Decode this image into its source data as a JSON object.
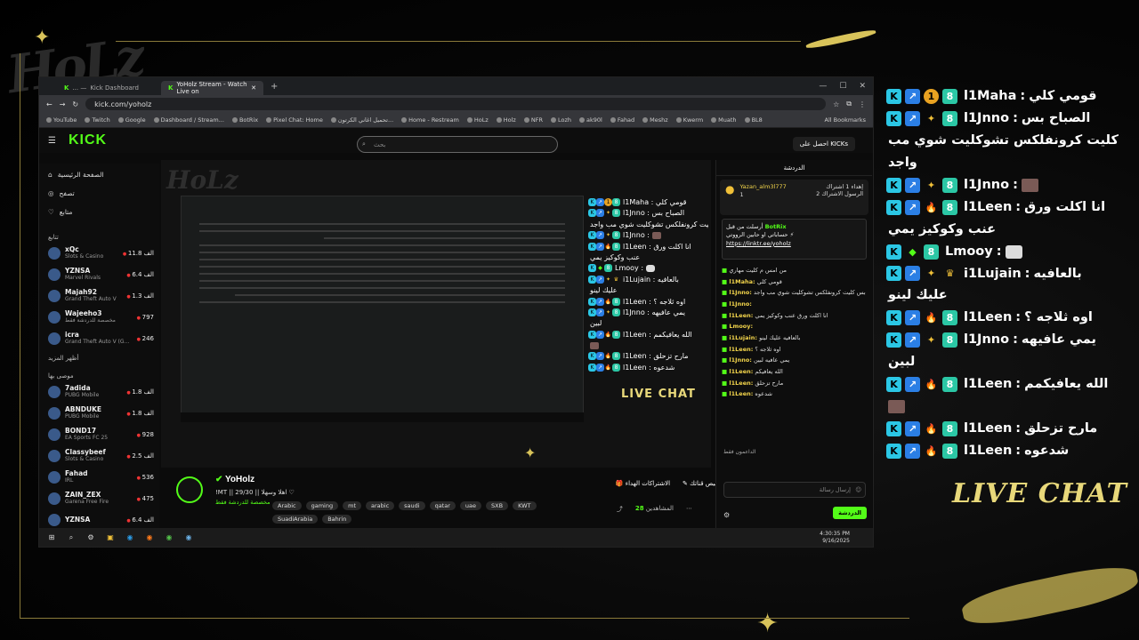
{
  "browser": {
    "tabs": [
      {
        "label": "Kick Dashboard",
        "prefix": "... —"
      },
      {
        "label": "YoHolz Stream - Watch Live on"
      }
    ],
    "url": "kick.com/yoholz",
    "bookmarks": [
      "YouTube",
      "Twitch",
      "Google",
      "Dashboard / Stream...",
      "BotRix",
      "Pixel Chat: Home",
      "تحميل اغاني الكرتون...",
      "Home - Restream",
      "HoLz",
      "Holz",
      "NFR",
      "Lozh",
      "ak90l",
      "Fahad",
      "Meshz",
      "Kwerm",
      "Muath",
      "BL8"
    ],
    "all_bookmarks": "All Bookmarks"
  },
  "kick": {
    "logo": "KICK",
    "search_placeholder": "بحث",
    "get_kicks": "احصل على KICKs",
    "nav": [
      "الصفحة الرئيسية",
      "تصفح",
      "متابع"
    ],
    "following_title": "تتابع",
    "following": [
      {
        "name": "xQc",
        "cat": "Slots & Casino",
        "viewers": "11.8 الف"
      },
      {
        "name": "YZNSA",
        "cat": "Marvel Rivals",
        "viewers": "6.4 الف"
      },
      {
        "name": "Majah92",
        "cat": "Grand Theft Auto V",
        "viewers": "1.3 الف"
      },
      {
        "name": "Wajeeho3",
        "cat": "مخصصة للدردشة فقط",
        "viewers": "797"
      },
      {
        "name": "icra",
        "cat": "Grand Theft Auto V (G...",
        "viewers": "246"
      }
    ],
    "show_more": "أظهر المزيد",
    "recommended_title": "موصى بها",
    "recommended": [
      {
        "name": "7adida",
        "cat": "PUBG Mobile",
        "viewers": "1.8 الف"
      },
      {
        "name": "ABNDUKE",
        "cat": "PUBG Mobile",
        "viewers": "1.8 الف"
      },
      {
        "name": "BOND17",
        "cat": "EA Sports FC 25",
        "viewers": "928"
      },
      {
        "name": "Classybeef",
        "cat": "Slots & Casino",
        "viewers": "2.5 الف"
      },
      {
        "name": "Fahad",
        "cat": "IRL",
        "viewers": "536"
      },
      {
        "name": "ZAIN_ZEX",
        "cat": "Garena Free Fire",
        "viewers": "475"
      },
      {
        "name": "YZNSA",
        "cat": "",
        "viewers": "6.4 الف"
      }
    ],
    "stream": {
      "channel": "YoHolz",
      "title": "!MT || 29/30 || اهلا وسهلا ♡",
      "category": "مخصصة للدردشة فقط",
      "tags": [
        "Arabic",
        "gaming",
        "mt",
        "arabic",
        "saudi",
        "qatar",
        "uae",
        "SXB",
        "KWT",
        "SuadiArabia",
        "Bahrin"
      ],
      "subs_btn": "الاشتراكات الهداء",
      "clip_btn": "تخصيص قناتك",
      "viewers_label": "المشاهدين",
      "viewers": "28"
    },
    "chat": {
      "header": "الدردشة",
      "pinned_user": "Yazan_alm3l777",
      "pinned_text": "إهداء 1 اشتراك الرسول الاشتراك 2",
      "pinned_count": "1",
      "bot_name": "BotRix",
      "bot_line1": "حساباتي او حابين الرووتي ⚡",
      "bot_link": "https://linktr.ee/yoholz",
      "bot_sent": "أرسلت من قبل",
      "messages": [
        {
          "u": "",
          "t": "من امس م كليت مهاري"
        },
        {
          "u": "l1Maha:",
          "t": "قومي كلي"
        },
        {
          "u": "l1Jnno:",
          "t": "الصباح بس كليت كرونفلكس تشوكليت شوي مب واجد."
        },
        {
          "u": "l1Jnno:",
          "t": ""
        },
        {
          "u": "l1Leen:",
          "t": "انا اكلت ورق عنب وكوكيز يمي"
        },
        {
          "u": "Lmooy:",
          "t": ""
        },
        {
          "u": "i1Lujain:",
          "t": "بالعافيه عليك لينو"
        },
        {
          "u": "l1Leen:",
          "t": "اوه ثلاجه ؟"
        },
        {
          "u": "l1Jnno:",
          "t": "يمي عافيه لبين"
        },
        {
          "u": "l1Leen:",
          "t": "الله يعافيكم"
        },
        {
          "u": "l1Leen:",
          "t": "مارح تزحلق"
        },
        {
          "u": "l1Leen:",
          "t": "شدعوه"
        }
      ],
      "supporters": "الداعمون فقط",
      "input_placeholder": "إرسال رسالة",
      "send_label": "الدردشة"
    }
  },
  "taskbar": {
    "time": "4:30:35 PM",
    "date": "9/16/2025"
  },
  "overlay": {
    "live_chat": "LIVE CHAT",
    "messages": [
      {
        "user": "l1Maha",
        "text": "قومي كلي",
        "badges": [
          "k",
          "s",
          "o",
          "g"
        ]
      },
      {
        "user": "l1Jnno",
        "text": "الصباح بس",
        "cont": "كليت كرونفلكس تشوكليت شوي مب واجد",
        "badges": [
          "k",
          "s",
          "y",
          "g"
        ]
      },
      {
        "user": "l1Jnno",
        "text": "",
        "emote": true,
        "badges": [
          "k",
          "s",
          "y",
          "g"
        ]
      },
      {
        "user": "l1Leen",
        "text": "انا اكلت ورق",
        "cont": "عنب وكوكيز يمي",
        "badges": [
          "k",
          "s",
          "f",
          "g"
        ]
      },
      {
        "user": "Lmooy",
        "text": "",
        "emote2": true,
        "badges": [
          "k",
          "d",
          "g"
        ]
      },
      {
        "user": "i1Lujain",
        "text": "بالعافيه",
        "cont": "عليك لينو",
        "badges": [
          "k",
          "s",
          "y",
          "c"
        ]
      },
      {
        "user": "l1Leen",
        "text": "اوه ثلاجه ؟",
        "badges": [
          "k",
          "s",
          "f",
          "g"
        ]
      },
      {
        "user": "l1Jnno",
        "text": "يمي عافيهه",
        "cont": "لبين",
        "badges": [
          "k",
          "s",
          "y",
          "g"
        ]
      },
      {
        "user": "l1Leen",
        "text": "الله يعافيكمم",
        "badges": [
          "k",
          "s",
          "f",
          "g"
        ],
        "emote_cont": true
      },
      {
        "user": "l1Leen",
        "text": "مارح تزحلق",
        "badges": [
          "k",
          "s",
          "f",
          "g"
        ]
      },
      {
        "user": "l1Leen",
        "text": "شدعوه",
        "badges": [
          "k",
          "s",
          "f",
          "g"
        ]
      }
    ]
  },
  "colors": {
    "kick_green": "#53fc18",
    "gold": "#e8d87a"
  }
}
